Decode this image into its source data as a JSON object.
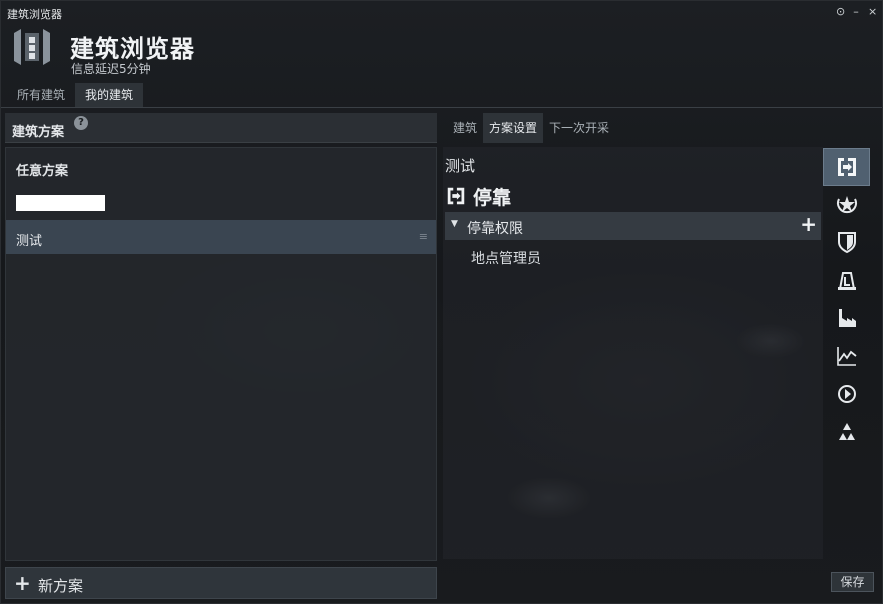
{
  "window": {
    "title": "建筑浏览器",
    "controls": {
      "settings": "⊙",
      "minimize": "–",
      "close": "×"
    }
  },
  "header": {
    "title": "建筑浏览器",
    "subtitle": "信息延迟5分钟"
  },
  "top_tabs": [
    {
      "label": "所有建筑"
    },
    {
      "label": "我的建筑",
      "active": true
    }
  ],
  "left_panel": {
    "title": "建筑方案",
    "help": "?",
    "any_plan": "任意方案",
    "plans": [
      {
        "label": "测试",
        "selected": true
      }
    ],
    "new_plan_label": "新方案"
  },
  "right_tabs": [
    {
      "label": "建筑"
    },
    {
      "label": "方案设置",
      "active": true
    },
    {
      "label": "下一次开采"
    }
  ],
  "right_panel": {
    "plan_name": "测试",
    "section": "停靠",
    "permission_group": "停靠权限",
    "permission_items": [
      "地点管理员"
    ]
  },
  "side_icons": [
    "docking-icon",
    "standings-icon",
    "defense-shield-icon",
    "reinforce-icon",
    "industry-factory-icon",
    "market-chart-icon",
    "jump-gate-icon",
    "recycle-icon"
  ],
  "save_label": "保存",
  "colors": {
    "accent_active": "#506070",
    "selected_row": "#3a4551"
  }
}
